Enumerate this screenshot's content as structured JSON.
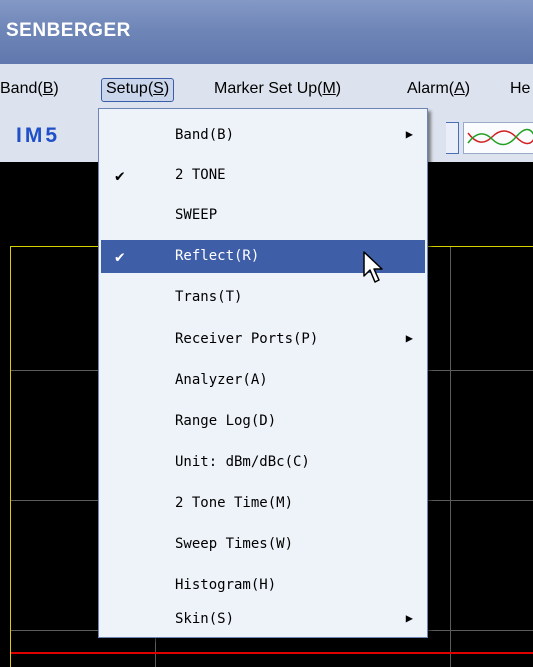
{
  "titlebar": {
    "title": "SENBERGER"
  },
  "menubar": {
    "items": [
      {
        "label": "Band(",
        "key": "B",
        "suffix": ")"
      },
      {
        "label": "Setup(",
        "key": "S",
        "suffix": ")"
      },
      {
        "label": "Marker Set Up(",
        "key": "M",
        "suffix": ")"
      },
      {
        "label": "Alarm(",
        "key": "A",
        "suffix": ")"
      },
      {
        "label": "He",
        "key": "",
        "suffix": ""
      }
    ]
  },
  "toolbar": {
    "mode_label": "IM5"
  },
  "setup_menu": {
    "items": [
      {
        "label": "Band(B)",
        "check": "",
        "arrow": "▶"
      },
      {
        "label": "2 TONE",
        "check": "✔",
        "arrow": ""
      },
      {
        "label": "SWEEP",
        "check": "",
        "arrow": ""
      },
      {
        "label": "Reflect(R)",
        "check": "✔",
        "arrow": ""
      },
      {
        "label": "Trans(T)",
        "check": "",
        "arrow": ""
      },
      {
        "label": "Receiver Ports(P)",
        "check": "",
        "arrow": "▶"
      },
      {
        "label": "Analyzer(A)",
        "check": "",
        "arrow": ""
      },
      {
        "label": "Range Log(D)",
        "check": "",
        "arrow": ""
      },
      {
        "label": "Unit: dBm/dBc(C)",
        "check": "",
        "arrow": ""
      },
      {
        "label": "2 Tone Time(M)",
        "check": "",
        "arrow": ""
      },
      {
        "label": "Sweep Times(W)",
        "check": "",
        "arrow": ""
      },
      {
        "label": "Histogram(H)",
        "check": "",
        "arrow": ""
      },
      {
        "label": "Skin(S)",
        "check": "",
        "arrow": "▶"
      }
    ]
  },
  "colors": {
    "highlight": "#3f5ea8",
    "plot_border": "#d8d000",
    "trace": "#e00000",
    "brand_text": "#2050c8"
  }
}
